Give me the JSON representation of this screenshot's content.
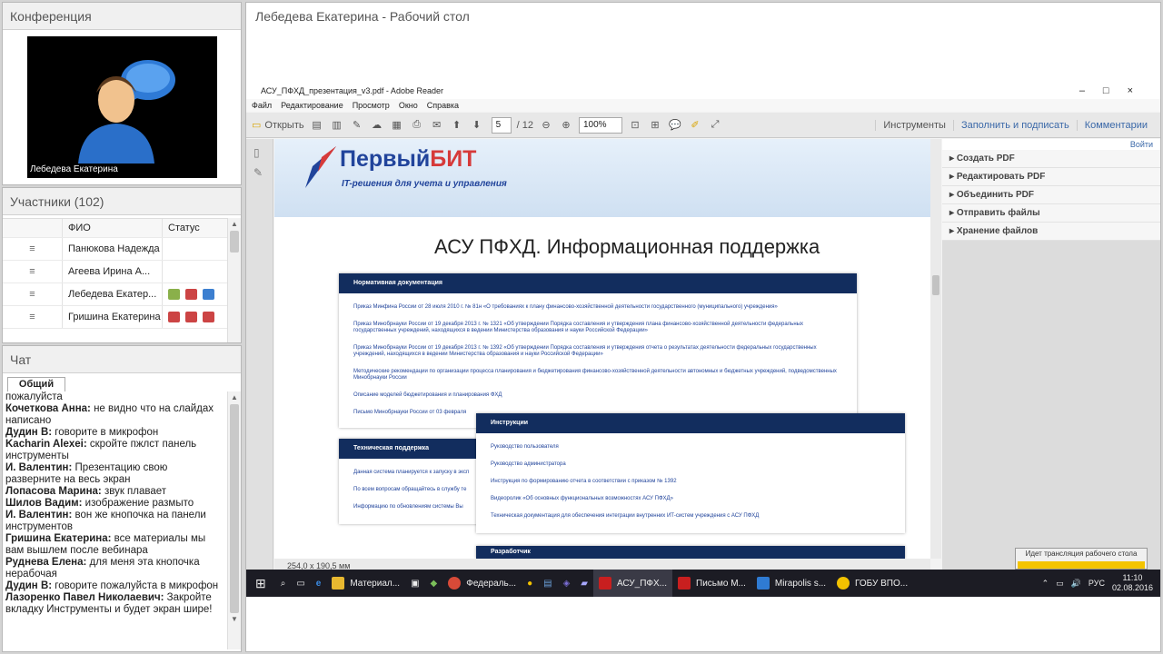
{
  "conference": {
    "title": "Конференция",
    "presenter_name": "Лебедева Екатерина"
  },
  "participants": {
    "title": "Участники (102)",
    "col_name": "ФИО",
    "col_status": "Статус",
    "rows": [
      "Панюкова Надежда",
      "Агеева Ирина  А...",
      "Лебедева Екатер...",
      "Гришина Екатерина"
    ]
  },
  "chat": {
    "title": "Чат",
    "tab": "Общий",
    "messages": [
      {
        "author": "",
        "text": "пожалуйста"
      },
      {
        "author": "Кочеткова Анна:",
        "text": " не видно что на слайдах написано"
      },
      {
        "author": "Дудин В:",
        "text": " говорите в микрофон"
      },
      {
        "author": "Kacharin Alexei:",
        "text": " скройте пжлст панель инструменты"
      },
      {
        "author": "И. Валентин:",
        "text": " Презентацию свою разверните на весь экран"
      },
      {
        "author": "Лопасова Марина:",
        "text": " звук плавает"
      },
      {
        "author": "Шилов Вадим:",
        "text": " изображение размыто"
      },
      {
        "author": "И. Валентин:",
        "text": " вон же кнопочка на панели инструментов"
      },
      {
        "author": "Гришина Екатерина:",
        "text": " все материалы мы вам вышлем после вебинара"
      },
      {
        "author": "Руднева Елена:",
        "text": " для меня эта кнопочка нерабочая"
      },
      {
        "author": "Дудин В:",
        "text": " говорите пожалуйста в микрофон"
      },
      {
        "author": "Лазоренко Павел Николаевич:",
        "text": " Закройте вкладку Инструменты и будет экран шире!"
      }
    ]
  },
  "desktop": {
    "title": "Лебедева Екатерина - Рабочий стол",
    "reader": {
      "window_title": "АСУ_ПФХД_презентация_v3.pdf - Adobe Reader",
      "menu": [
        "Файл",
        "Редактирование",
        "Просмотр",
        "Окно",
        "Справка"
      ],
      "open_label": "Открыть",
      "page_current": "5",
      "page_total": "/ 12",
      "zoom": "100%",
      "tools": "Инструменты",
      "fill_sign": "Заполнить и подписать",
      "comments": "Комментарии",
      "login": "Войти",
      "panel_items": [
        "Создать PDF",
        "Редактировать PDF",
        "Объединить PDF",
        "Отправить файлы",
        "Хранение файлов"
      ],
      "page_size": "254,0 x 190,5 мм"
    },
    "slide": {
      "logo_a": "Первый",
      "logo_b": "БИТ",
      "logo_tag": "IT-решения для учета и управления",
      "heading": "АСУ ПФХД. Информационная поддержка",
      "box1_title": "Нормативная документация",
      "box1_items": [
        "Приказ Минфина России от 28 июля 2010 г. № 81н «О требованиях к плану финансово-хозяйственной деятельности государственного (муниципального) учреждения»",
        "Приказ Минобрнауки России от 19 декабря 2013 г. № 1321 «Об утверждении Порядка составления и утверждения плана финансово-хозяйственной деятельности федеральных государственных учреждений, находящихся в ведении Министерства образования и науки Российской Федерации»",
        "Приказ Минобрнауки России от 19 декабря 2013 г. № 1392 «Об утверждении Порядка составления и утверждения отчета о результатах деятельности федеральных государственных учреждений, находящихся в ведении Министерства образования и науки Российской Федерации»",
        "Методические рекомендации по организации процесса планирования и бюджетирования финансово-хозяйственной деятельности автономных и бюджетных учреждений, подведомственных Минобрнауки России",
        "Описание моделей бюджетирования и планирования ФХД",
        "Письмо Минобрнауки России от 03 февраля"
      ],
      "box2_title": "Техническая поддержка",
      "box2_items": [
        "Данная система планируется к запуску в эксп",
        "По всем вопросам обращайтесь в службу те",
        "Информацию по обновлениям системы Вы"
      ],
      "box3_title": "Инструкции",
      "box3_items": [
        "Руководство пользователя",
        "Руководство администратора",
        "Инструкция по формированию отчета в соответствии с приказом № 1392",
        "Видеоролик «Об основных функциональных возможностях АСУ ПФХД»",
        "Техническая документация для обеспечения интеграции внутренних ИТ-систем учреждения с АСУ ПФХД"
      ],
      "box4_title": "Разработчик"
    },
    "taskbar": {
      "items": [
        "Материал...",
        "Федераль...",
        "АСУ_ПФХ...",
        "Письмо М...",
        "Mirapolis s...",
        "ГОБУ ВПО..."
      ],
      "lang": "РУС",
      "time": "11:10",
      "date": "02.08.2016"
    },
    "notification": "Идет трансляция рабочего стола"
  },
  "colors": {
    "accent": "#122d5e",
    "logo_blue": "#21449b",
    "logo_red": "#d63a3a",
    "taskbar": "#1c1c24"
  }
}
